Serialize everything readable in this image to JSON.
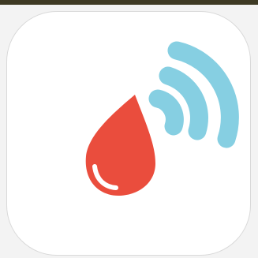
{
  "app_icon": {
    "icon_name": "blood-drop-wireless-icon",
    "colors": {
      "top_bar": "#3e3a24",
      "background": "#f3f3f3",
      "tile": "#ffffff",
      "border": "#d9d9d9",
      "drop": "#ea4d3d",
      "drop_highlight": "#ffffff",
      "signal": "#86cfe2"
    }
  }
}
